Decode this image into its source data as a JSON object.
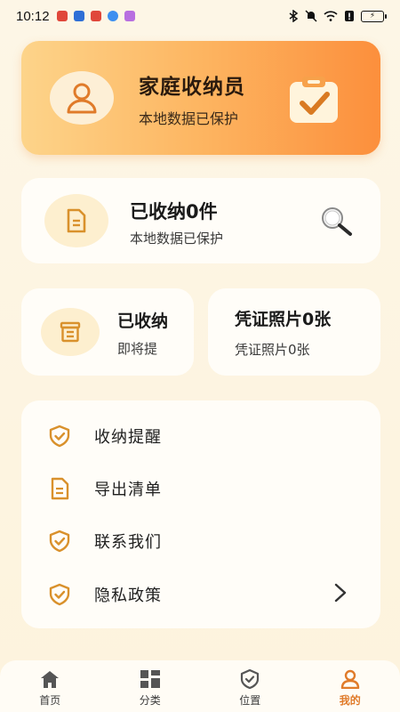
{
  "status_bar": {
    "time": "10:12"
  },
  "header": {
    "title": "家庭收纳员",
    "subtitle": "本地数据已保护"
  },
  "summary_card": {
    "title": "已收纳0件",
    "subtitle": "本地数据已保护"
  },
  "stored_card": {
    "title": "已收纳",
    "subtitle": "即将提"
  },
  "photos_card": {
    "title": "凭证照片0张",
    "subtitle": "凭证照片0张"
  },
  "menu": {
    "items": [
      {
        "label": "收纳提醒",
        "icon": "shield-check-icon"
      },
      {
        "label": "导出清单",
        "icon": "document-icon"
      },
      {
        "label": "联系我们",
        "icon": "shield-check-icon"
      },
      {
        "label": "隐私政策",
        "icon": "shield-check-icon"
      }
    ]
  },
  "nav": {
    "items": [
      {
        "label": "首页",
        "icon": "home-icon"
      },
      {
        "label": "分类",
        "icon": "grid-icon"
      },
      {
        "label": "位置",
        "icon": "location-shield-icon"
      },
      {
        "label": "我的",
        "icon": "person-icon"
      }
    ]
  },
  "colors": {
    "accent": "#e07b2a",
    "icon_gold": "#d9912c",
    "background": "#fdf6e6"
  }
}
